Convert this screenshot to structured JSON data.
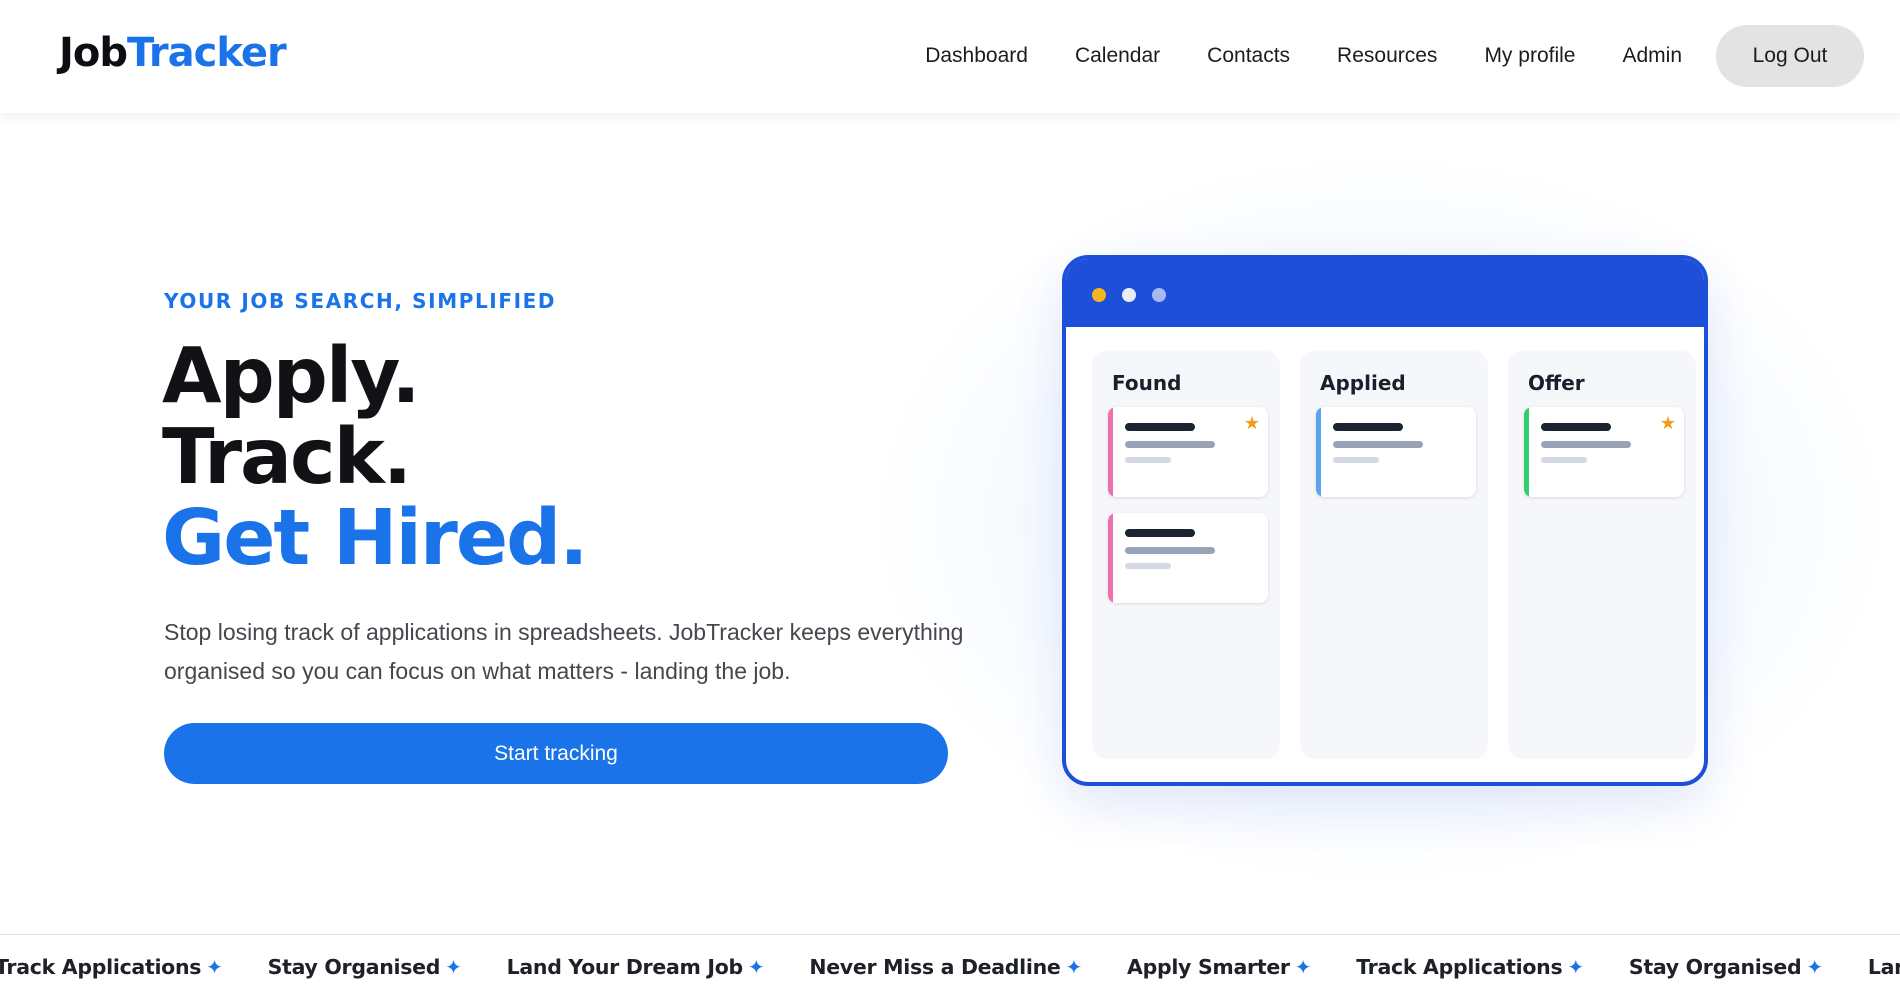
{
  "logo": {
    "part1": "Job",
    "part2": "Tracker"
  },
  "nav": {
    "links": [
      "Dashboard",
      "Calendar",
      "Contacts",
      "Resources",
      "My profile",
      "Admin"
    ],
    "logout_label": "Log Out"
  },
  "hero": {
    "eyebrow": "YOUR JOB SEARCH, SIMPLIFIED",
    "headline_line1": "Apply.",
    "headline_line2": "Track.",
    "headline_line3": "Get Hired.",
    "lead": "Stop losing track of applications in spreadsheets. JobTracker keeps everything organised so you can focus on what matters - landing the job.",
    "cta_label": "Start tracking"
  },
  "mockup": {
    "columns": [
      {
        "title": "Found",
        "cards": [
          {
            "accent": "#f06fae",
            "starred": true
          },
          {
            "accent": "#f06fae",
            "starred": false
          }
        ]
      },
      {
        "title": "Applied",
        "cards": [
          {
            "accent": "#5aa3ef",
            "starred": false
          }
        ]
      },
      {
        "title": "Offer",
        "cards": [
          {
            "accent": "#2fcf6f",
            "starred": true
          }
        ]
      }
    ],
    "window_dots": [
      "#f6b51e",
      "#e8edf8",
      "#a9b8f0"
    ]
  },
  "marquee": {
    "items": [
      "Track Applications",
      "Stay Organised",
      "Land Your Dream Job",
      "Never Miss a Deadline",
      "Apply Smarter",
      "Track Applications",
      "Stay Organised",
      "Land Your Dr"
    ],
    "icon": "sparkle-icon"
  },
  "colors": {
    "accent": "#1a73e8",
    "mockup_blue": "#1e4fd9",
    "star": "#f29a1a"
  }
}
